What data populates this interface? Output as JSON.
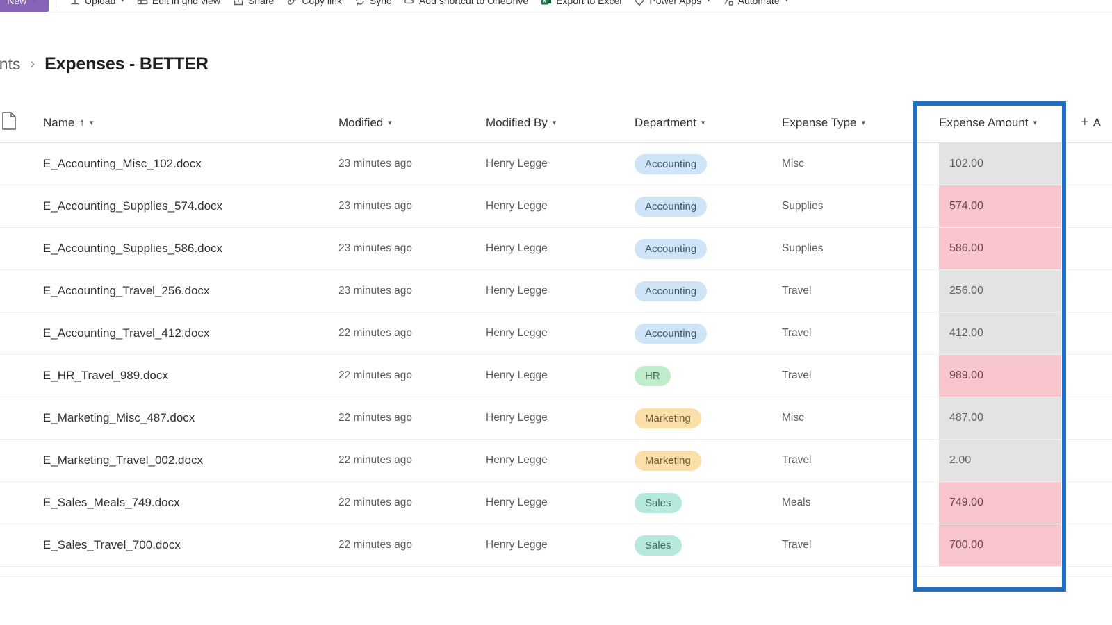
{
  "commandbar": {
    "new_button": {
      "label": "New",
      "caret": "⌄"
    },
    "items": [
      {
        "label": "Upload",
        "icon": "upload-icon",
        "has_caret": true
      },
      {
        "label": "Edit in grid view",
        "icon": "grid-icon",
        "has_caret": false
      },
      {
        "label": "Share",
        "icon": "share-icon",
        "has_caret": false
      },
      {
        "label": "Copy link",
        "icon": "link-icon",
        "has_caret": false
      },
      {
        "label": "Sync",
        "icon": "sync-icon",
        "has_caret": false
      },
      {
        "label": "Add shortcut to OneDrive",
        "icon": "cloud-add-icon",
        "has_caret": false
      },
      {
        "label": "Export to Excel",
        "icon": "excel-icon",
        "has_caret": false
      },
      {
        "label": "Power Apps",
        "icon": "powerapps-icon",
        "has_caret": true
      },
      {
        "label": "Automate",
        "icon": "automate-icon",
        "has_caret": true
      }
    ]
  },
  "breadcrumb": {
    "parent": "ents",
    "separator": "›",
    "current": "Expenses - BETTER"
  },
  "grid": {
    "columns": [
      {
        "key": "icon",
        "label": "",
        "sort": "",
        "chevron": false
      },
      {
        "key": "name",
        "label": "Name",
        "sort": "↑",
        "chevron": true
      },
      {
        "key": "mod",
        "label": "Modified",
        "sort": "",
        "chevron": true
      },
      {
        "key": "modby",
        "label": "Modified By",
        "sort": "",
        "chevron": true
      },
      {
        "key": "dept",
        "label": "Department",
        "sort": "",
        "chevron": true
      },
      {
        "key": "type",
        "label": "Expense Type",
        "sort": "",
        "chevron": true
      },
      {
        "key": "amt",
        "label": "Expense Amount",
        "sort": "",
        "chevron": true
      }
    ],
    "add_column": {
      "plus": "+",
      "label": "A"
    },
    "rows": [
      {
        "name": "E_Accounting_Misc_102.docx",
        "modified": "23 minutes ago",
        "modified_by": "Henry Legge",
        "department": "Accounting",
        "dept_style": "pill-accounting",
        "expense_type": "Misc",
        "amount": "102.00",
        "amount_style": "amt-gray"
      },
      {
        "name": "E_Accounting_Supplies_574.docx",
        "modified": "23 minutes ago",
        "modified_by": "Henry Legge",
        "department": "Accounting",
        "dept_style": "pill-accounting",
        "expense_type": "Supplies",
        "amount": "574.00",
        "amount_style": "amt-pink"
      },
      {
        "name": "E_Accounting_Supplies_586.docx",
        "modified": "23 minutes ago",
        "modified_by": "Henry Legge",
        "department": "Accounting",
        "dept_style": "pill-accounting",
        "expense_type": "Supplies",
        "amount": "586.00",
        "amount_style": "amt-pink"
      },
      {
        "name": "E_Accounting_Travel_256.docx",
        "modified": "23 minutes ago",
        "modified_by": "Henry Legge",
        "department": "Accounting",
        "dept_style": "pill-accounting",
        "expense_type": "Travel",
        "amount": "256.00",
        "amount_style": "amt-gray"
      },
      {
        "name": "E_Accounting_Travel_412.docx",
        "modified": "22 minutes ago",
        "modified_by": "Henry Legge",
        "department": "Accounting",
        "dept_style": "pill-accounting",
        "expense_type": "Travel",
        "amount": "412.00",
        "amount_style": "amt-gray"
      },
      {
        "name": "E_HR_Travel_989.docx",
        "modified": "22 minutes ago",
        "modified_by": "Henry Legge",
        "department": "HR",
        "dept_style": "pill-hr",
        "expense_type": "Travel",
        "amount": "989.00",
        "amount_style": "amt-pink"
      },
      {
        "name": "E_Marketing_Misc_487.docx",
        "modified": "22 minutes ago",
        "modified_by": "Henry Legge",
        "department": "Marketing",
        "dept_style": "pill-marketing",
        "expense_type": "Misc",
        "amount": "487.00",
        "amount_style": "amt-gray"
      },
      {
        "name": "E_Marketing_Travel_002.docx",
        "modified": "22 minutes ago",
        "modified_by": "Henry Legge",
        "department": "Marketing",
        "dept_style": "pill-marketing",
        "expense_type": "Travel",
        "amount": "2.00",
        "amount_style": "amt-gray"
      },
      {
        "name": "E_Sales_Meals_749.docx",
        "modified": "22 minutes ago",
        "modified_by": "Henry Legge",
        "department": "Sales",
        "dept_style": "pill-sales",
        "expense_type": "Meals",
        "amount": "749.00",
        "amount_style": "amt-pink"
      },
      {
        "name": "E_Sales_Travel_700.docx",
        "modified": "22 minutes ago",
        "modified_by": "Henry Legge",
        "department": "Sales",
        "dept_style": "pill-sales",
        "expense_type": "Travel",
        "amount": "700.00",
        "amount_style": "amt-pink"
      }
    ]
  },
  "annotation": {
    "highlight_color": "#1f6fc4",
    "highlighted_column": "Expense Amount"
  },
  "colors": {
    "new_button": "#8764b8",
    "amount_low": "#e3e3e3",
    "amount_high": "#f7c5cb",
    "pill_accounting": "#cfe4f7",
    "pill_hr": "#bfeccb",
    "pill_marketing": "#fbdfa9",
    "pill_sales": "#b7e8de"
  }
}
